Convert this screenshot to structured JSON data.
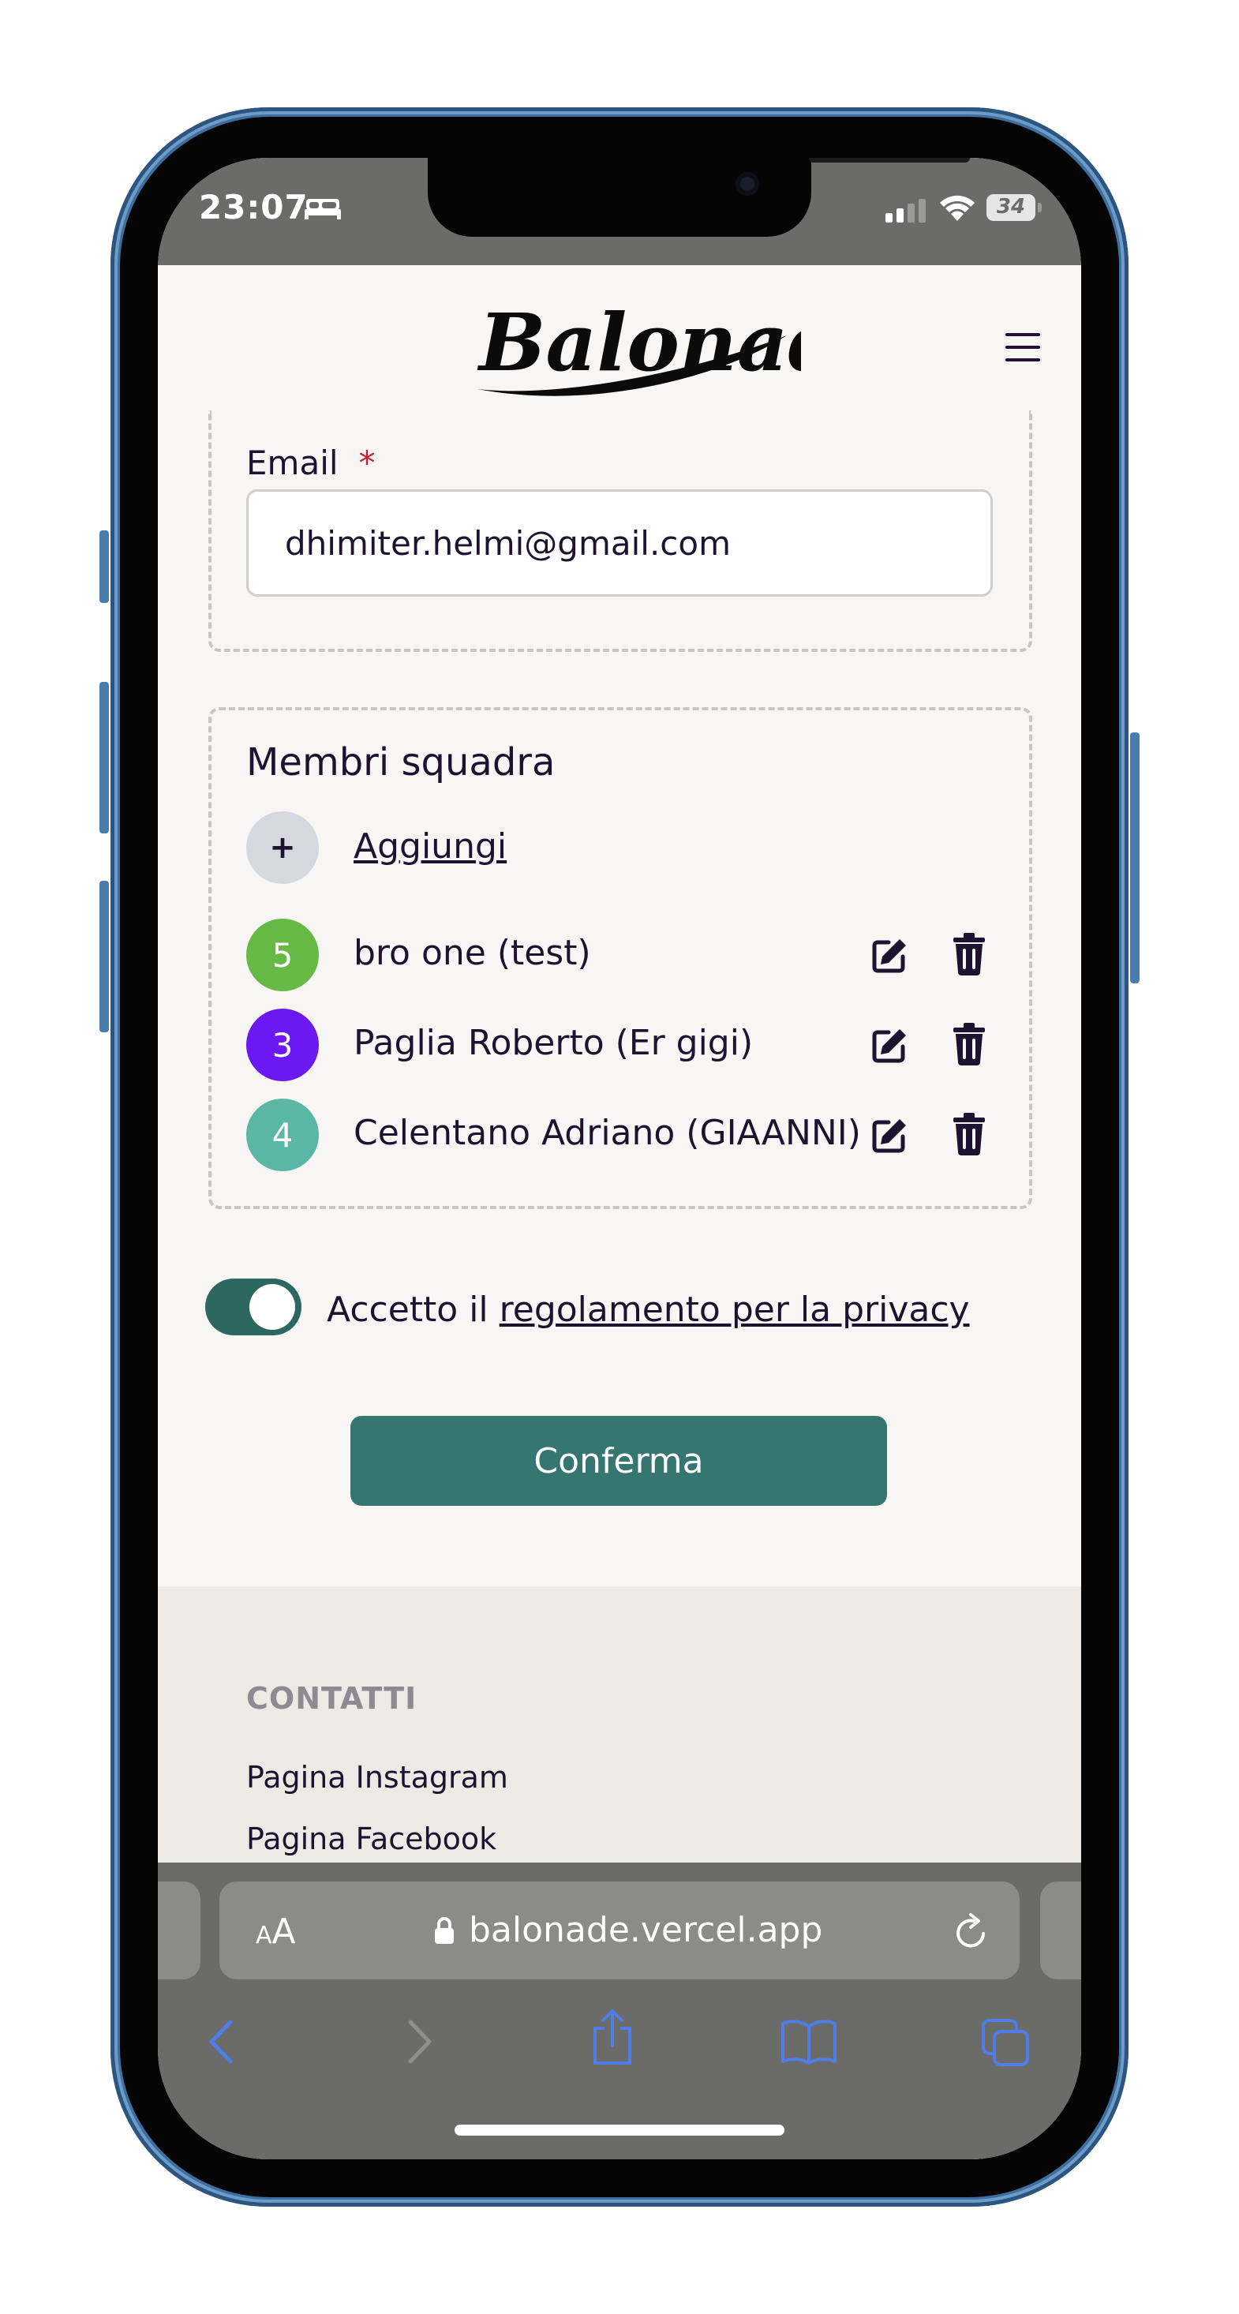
{
  "status_bar": {
    "time": "23:07",
    "battery": "34"
  },
  "header": {
    "logo_text": "Balonade"
  },
  "form": {
    "email_label": "Email",
    "required_mark": "*",
    "email_value": "dhimiter.helmi@gmail.com",
    "members": {
      "title": "Membri squadra",
      "add_symbol": "+",
      "add_label": "Aggiungi",
      "items": [
        {
          "number": "5",
          "name": "bro one (test)",
          "color": "#66b945"
        },
        {
          "number": "3",
          "name": "Paglia Roberto (Er gigi)",
          "color": "#6b18f2"
        },
        {
          "number": "4",
          "name": "Celentano Adriano (GIAANNI)",
          "color": "#5bb7a5"
        }
      ]
    },
    "privacy": {
      "prefix": "Accetto il ",
      "link": "regolamento per la privacy",
      "checked": true
    },
    "confirm_label": "Conferma"
  },
  "footer": {
    "title": "CONTATTI",
    "links": [
      "Pagina Instagram",
      "Pagina Facebook"
    ]
  },
  "safari": {
    "aa_small": "A",
    "aa_big": "A",
    "url": "balonade.vercel.app"
  },
  "colors": {
    "primary": "#357670",
    "text": "#1d1331",
    "required": "#c0213a",
    "safari_tint": "#4f7ee8"
  }
}
